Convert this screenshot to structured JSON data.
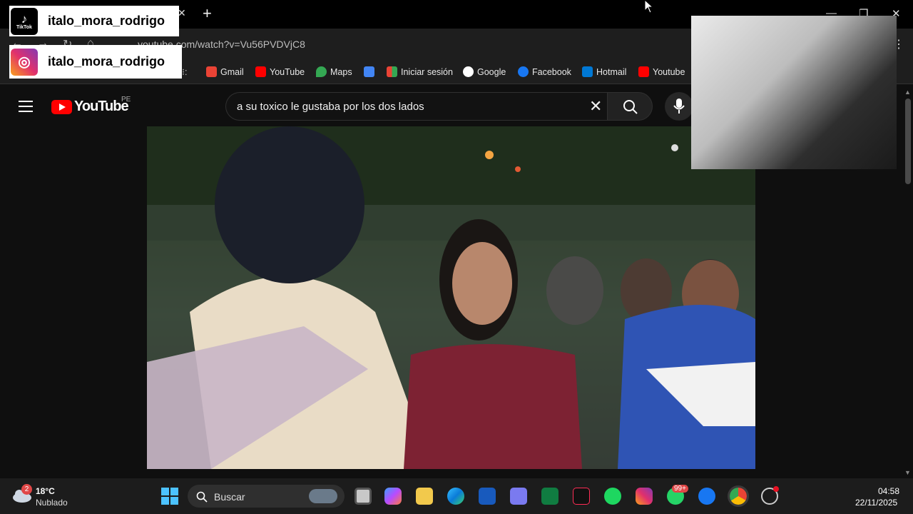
{
  "browser": {
    "url": "youtube.com/watch?v=Vu56PVDVjC8",
    "bookmarks": [
      {
        "label": "Gmail",
        "color": "#ea4335"
      },
      {
        "label": "YouTube",
        "color": "#ff0000"
      },
      {
        "label": "Maps",
        "color": "#34a853"
      },
      {
        "label": "Iniciar sesión",
        "color": "#4285f4"
      },
      {
        "label": "Google",
        "color": "#4285f4"
      },
      {
        "label": "Facebook",
        "color": "#1877f2"
      },
      {
        "label": "Hotmail",
        "color": "#0078d4"
      },
      {
        "label": "Youtube",
        "color": "#ff0000"
      }
    ]
  },
  "overlay": {
    "tiktok_handle": "italo_mora_rodrigo",
    "tiktok_label": "TikTok",
    "instagram_handle": "italo_mora_rodrigo"
  },
  "youtube": {
    "logo_text": "YouTube",
    "country_code": "PE",
    "search_query": "a su toxico le gustaba por los dos lados"
  },
  "taskbar": {
    "weather_temp": "18°C",
    "weather_desc": "Nublado",
    "weather_badge": "2",
    "search_placeholder": "Buscar",
    "whatsapp_badge": "99+",
    "time": "04:58",
    "date": "22/11/2025"
  }
}
